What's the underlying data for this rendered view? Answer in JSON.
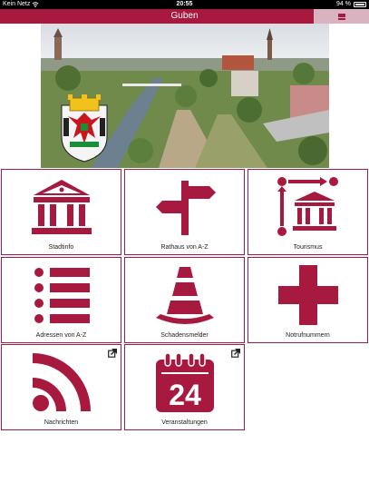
{
  "status_bar": {
    "carrier": "Kein Netz",
    "time": "20:55",
    "battery": "94 %"
  },
  "header": {
    "title": "Guben"
  },
  "tiles": [
    {
      "label": "Stadtinfo"
    },
    {
      "label": "Rathaus von A-Z"
    },
    {
      "label": "Tourismus"
    },
    {
      "label": "Adressen von A-Z"
    },
    {
      "label": "Schadensmelder"
    },
    {
      "label": "Notrufnummern"
    },
    {
      "label": "Nachrichten"
    },
    {
      "label": "Veranstaltungen",
      "calendar_number": "24"
    }
  ],
  "colors": {
    "accent": "#a8193f",
    "menu_button": "#d9b3bf"
  }
}
